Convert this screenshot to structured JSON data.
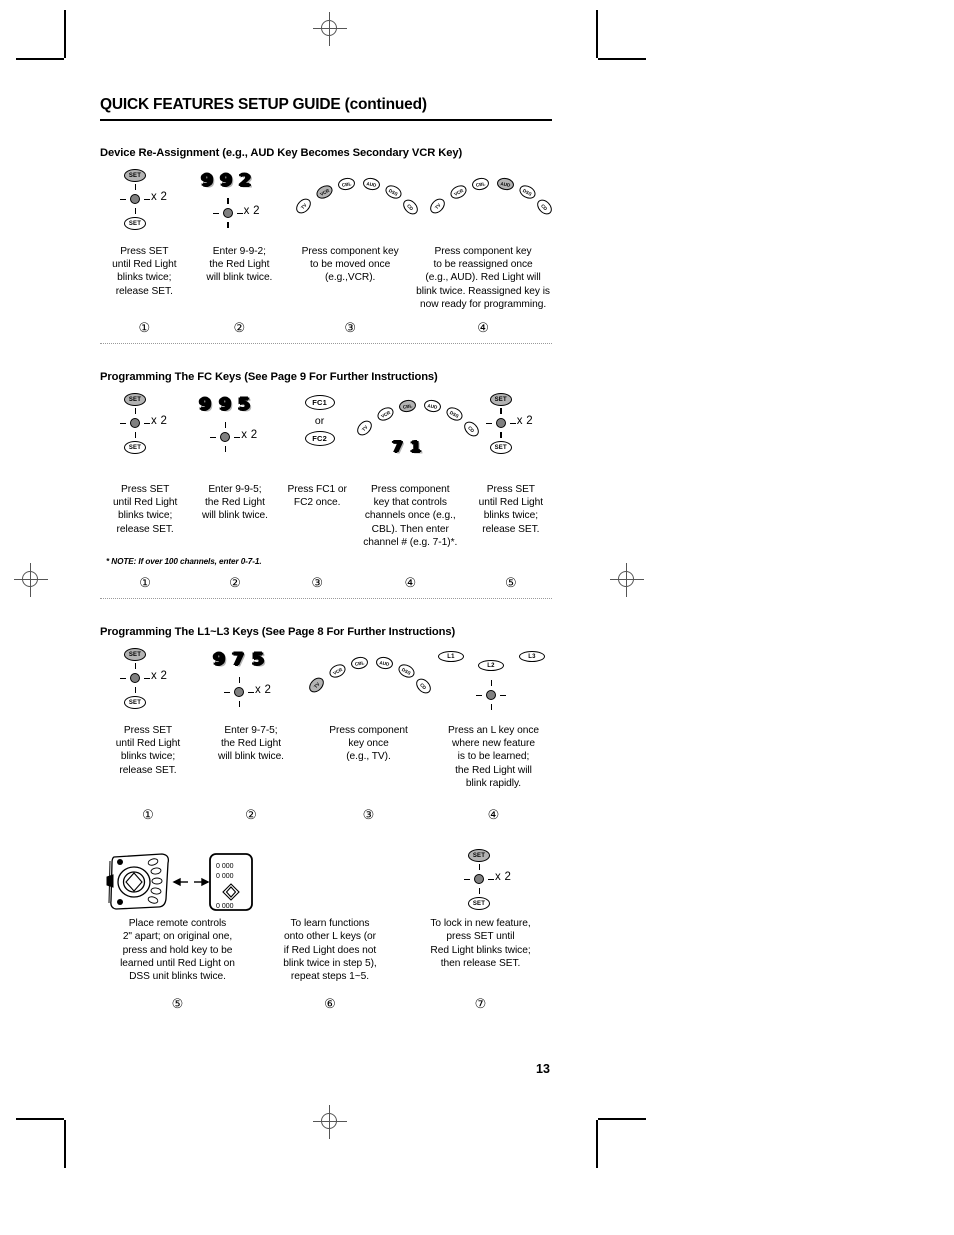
{
  "header": {
    "title_bold": "QUICK FEATURES SETUP GUIDE",
    "title_paren": " (continued)"
  },
  "page_number": "13",
  "component_keys": [
    "TV",
    "VCR",
    "CBL",
    "AUD",
    "DSS",
    "CD"
  ],
  "sections": [
    {
      "id": "device-reassignment",
      "title": "Device Re-Assignment (e.g., AUD Key Becomes Secondary VCR Key)",
      "note": "",
      "steps": [
        {
          "number": "①",
          "art": "set-blink-set",
          "multiplier": "x 2",
          "top_key": "SET",
          "bottom_key": "SET",
          "caption": "Press SET\nuntil Red Light\nblinks twice;\nrelease SET."
        },
        {
          "number": "②",
          "art": "digits-blink",
          "digits": [
            "9",
            "9",
            "2"
          ],
          "multiplier": "x 2",
          "caption": "Enter 9-9-2;\nthe Red Light\nwill blink twice."
        },
        {
          "number": "③",
          "art": "key-arc",
          "highlight": "VCR",
          "caption": "Press component key\nto be moved once\n(e.g.,VCR)."
        },
        {
          "number": "④",
          "art": "key-arc",
          "highlight": "AUD",
          "caption": "Press component key\nto be reassigned once\n(e.g., AUD). Red Light will\nblink twice. Reassigned key is\nnow ready for programming."
        }
      ]
    },
    {
      "id": "fc-keys",
      "title": "Programming The FC Keys (See Page 9 For Further Instructions)",
      "note": "* NOTE: If over 100 channels, enter 0-7-1.",
      "steps": [
        {
          "number": "①",
          "art": "set-blink-set",
          "multiplier": "x 2",
          "top_key": "SET",
          "bottom_key": "SET",
          "caption": "Press SET\nuntil Red Light\nblinks twice;\nrelease SET."
        },
        {
          "number": "②",
          "art": "digits-blink",
          "digits": [
            "9",
            "9",
            "5"
          ],
          "multiplier": "x 2",
          "caption": "Enter 9-9-5;\nthe Red Light\nwill blink twice."
        },
        {
          "number": "③",
          "art": "fc-pills",
          "fc1": "FC1",
          "or": "or",
          "fc2": "FC2",
          "caption": "Press FC1 or\nFC2 once."
        },
        {
          "number": "④",
          "art": "key-arc-digits",
          "highlight": "CBL",
          "digits": [
            "7",
            "1"
          ],
          "caption": "Press component\nkey that controls\nchannels once (e.g.,\nCBL). Then enter\nchannel # (e.g. 7-1)*."
        },
        {
          "number": "⑤",
          "art": "set-blink-set",
          "multiplier": "x 2",
          "top_key": "SET",
          "bottom_key": "SET",
          "caption": "Press SET\nuntil Red Light\nblinks twice;\nrelease SET."
        }
      ]
    },
    {
      "id": "l-keys",
      "title": "Programming The L1~L3 Keys (See Page 8 For Further Instructions)",
      "note": "",
      "steps": [
        {
          "number": "①",
          "art": "set-blink-set",
          "multiplier": "x 2",
          "top_key": "SET",
          "bottom_key": "SET",
          "caption": "Press SET\nuntil Red Light\nblinks twice;\nrelease SET."
        },
        {
          "number": "②",
          "art": "digits-blink",
          "digits": [
            "9",
            "7",
            "5"
          ],
          "multiplier": "x 2",
          "caption": "Enter 9-7-5;\nthe Red Light\nwill blink twice."
        },
        {
          "number": "③",
          "art": "key-arc",
          "highlight": "TV",
          "caption": "Press component\nkey once\n(e.g., TV)."
        },
        {
          "number": "④",
          "art": "l-keys-blink",
          "l_keys": [
            "L1",
            "L2",
            "L3"
          ],
          "caption": "Press an L key once\nwhere new feature\nis to be learned;\nthe Red Light will\nblink rapidly."
        }
      ]
    },
    {
      "id": "l-keys-continued",
      "title": "",
      "note": "",
      "steps": [
        {
          "number": "⑤",
          "art": "remotes",
          "caption": "Place remote controls\n2\" apart; on original one,\npress and hold key to be\nlearned until Red Light on\nDSS unit blinks twice."
        },
        {
          "number": "⑥",
          "art": "none",
          "caption": "To learn functions\nonto other L keys (or\nif Red Light does not\nblink twice in step 5),\nrepeat steps 1~5."
        },
        {
          "number": "⑦",
          "art": "set-blink-set",
          "multiplier": "x 2",
          "top_key": "SET",
          "bottom_key": "SET",
          "caption": "To lock in new feature,\npress SET until\nRed Light blinks twice;\nthen release SET."
        }
      ]
    }
  ],
  "colors": {
    "ink": "#000000",
    "key_highlight": "#b3b3b3",
    "light_bulb": "#808080",
    "divider": "#9a9a9a"
  },
  "remote_panel": {
    "display_rows": [
      "0  000",
      "0  000",
      "0  000"
    ]
  }
}
